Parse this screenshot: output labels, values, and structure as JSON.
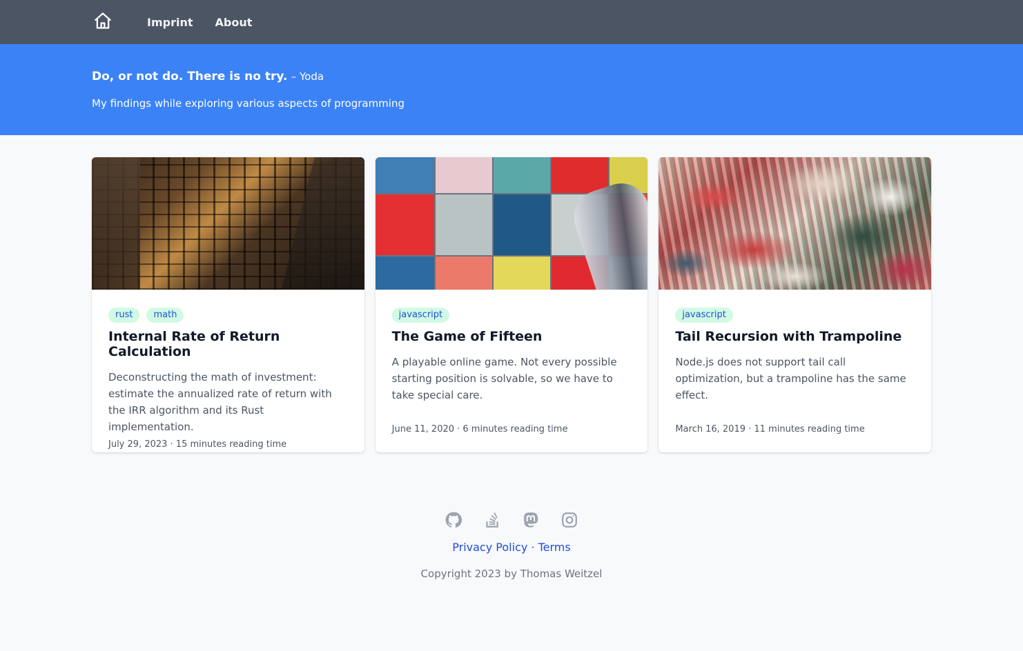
{
  "nav": {
    "home_icon": "home-icon",
    "links": [
      "Imprint",
      "About"
    ]
  },
  "hero": {
    "quote": "Do, or not do. There is no try.",
    "quote_author": "– Yoda",
    "tagline": "My findings while exploring various aspects of programming"
  },
  "posts": [
    {
      "tags": [
        "rust",
        "math"
      ],
      "title": "Internal Rate of Return Calculation",
      "description": "Deconstructing the math of investment: estimate the annualized rate of return with the IRR algorithm and its Rust implementation.",
      "meta": "July 29, 2023 · 15 minutes reading time"
    },
    {
      "tags": [
        "javascript"
      ],
      "title": "The Game of Fifteen",
      "description": "A playable online game. Not every possible starting position is solvable, so we have to take special care.",
      "meta": "June 11, 2020 · 6 minutes reading time"
    },
    {
      "tags": [
        "javascript"
      ],
      "title": "Tail Recursion with Trampoline",
      "description": "Node.js does not support tail call optimization, but a trampoline has the same effect.",
      "meta": "March 16, 2019 · 11 minutes reading time"
    }
  ],
  "footer": {
    "social_icons": [
      "github-icon",
      "stackoverflow-icon",
      "mastodon-icon",
      "instagram-icon"
    ],
    "privacy": "Privacy Policy",
    "separator": "·",
    "terms": "Terms",
    "copyright": "Copyright 2023 by Thomas Weitzel"
  },
  "colors": {
    "nav_bg": "#4b5563",
    "hero_bg": "#3b82f6",
    "tag_bg": "#d1fae5",
    "link": "#1d4ed8"
  }
}
